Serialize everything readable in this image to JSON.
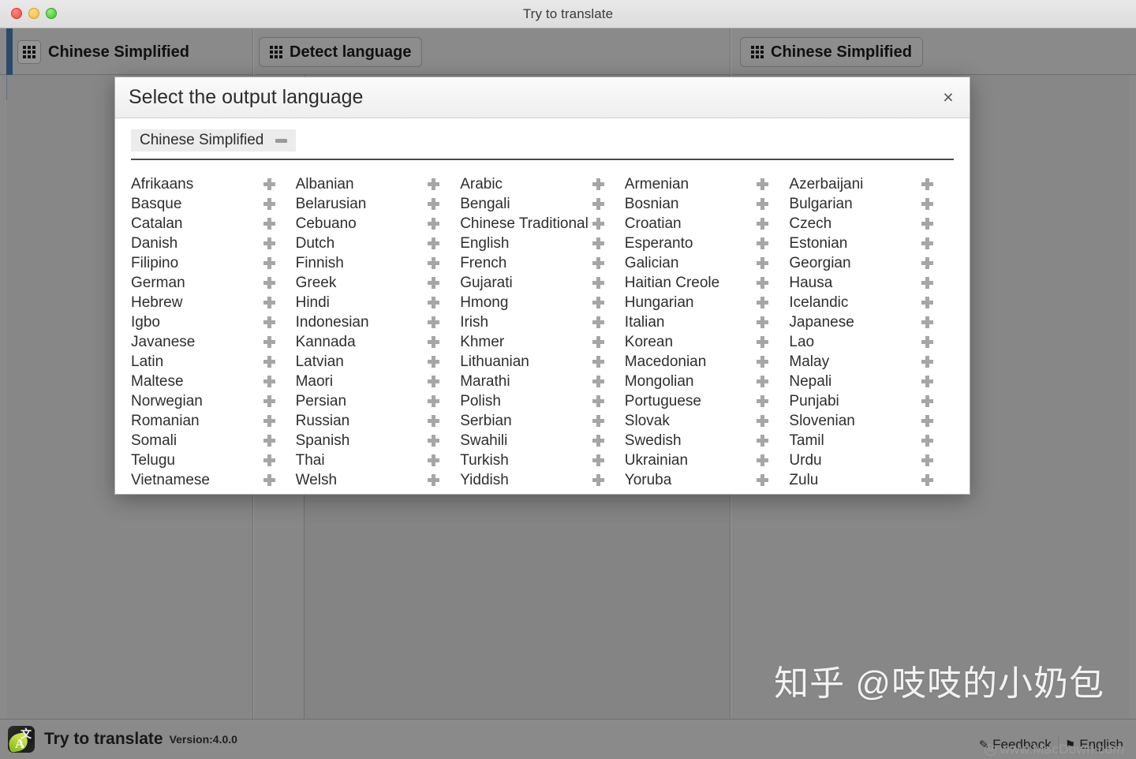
{
  "window": {
    "title": "Try to translate",
    "traffic_lights": [
      "close-button",
      "minimize-button",
      "zoom-button"
    ]
  },
  "toolbar": {
    "source_language": "Chinese Simplified",
    "detect_language": "Detect language",
    "target_language": "Chinese Simplified",
    "selected_sub_row": "Chinese Simplified"
  },
  "dialog": {
    "title": "Select the output language",
    "close_label": "×",
    "selected_chip": "Chinese Simplified",
    "columns": [
      [
        "Afrikaans",
        "Basque",
        "Catalan",
        "Danish",
        "Filipino",
        "German",
        "Hebrew",
        "Igbo",
        "Javanese",
        "Latin",
        "Maltese",
        "Norwegian",
        "Romanian",
        "Somali",
        "Telugu",
        "Vietnamese"
      ],
      [
        "Albanian",
        "Belarusian",
        "Cebuano",
        "Dutch",
        "Finnish",
        "Greek",
        "Hindi",
        "Indonesian",
        "Kannada",
        "Latvian",
        "Maori",
        "Persian",
        "Russian",
        "Spanish",
        "Thai",
        "Welsh"
      ],
      [
        "Arabic",
        "Bengali",
        "Chinese Traditional",
        "English",
        "French",
        "Gujarati",
        "Hmong",
        "Irish",
        "Khmer",
        "Lithuanian",
        "Marathi",
        "Polish",
        "Serbian",
        "Swahili",
        "Turkish",
        "Yiddish"
      ],
      [
        "Armenian",
        "Bosnian",
        "Croatian",
        "Esperanto",
        "Galician",
        "Haitian Creole",
        "Hungarian",
        "Italian",
        "Korean",
        "Macedonian",
        "Mongolian",
        "Portuguese",
        "Slovak",
        "Swedish",
        "Ukrainian",
        "Yoruba"
      ],
      [
        "Azerbaijani",
        "Bulgarian",
        "Czech",
        "Estonian",
        "Georgian",
        "Hausa",
        "Icelandic",
        "Japanese",
        "Lao",
        "Malay",
        "Nepali",
        "Punjabi",
        "Slovenian",
        "Tamil",
        "Urdu",
        "Zulu"
      ]
    ]
  },
  "statusbar": {
    "app_name": "Try to translate",
    "version": "Version:4.0.0",
    "feedback": "Feedback",
    "language": "English"
  },
  "watermarks": {
    "zhihu": "知乎 @吱吱的小奶包",
    "macdown": "www.MacDown.com",
    "macdown_mark": "M"
  },
  "colors": {
    "window_bg": "#8a8a8a",
    "accent_blue": "#2b4a6b",
    "selection_blue": "#5f7285",
    "dialog_bg": "#ffffff",
    "plus_icon": "#a6a6a6"
  }
}
